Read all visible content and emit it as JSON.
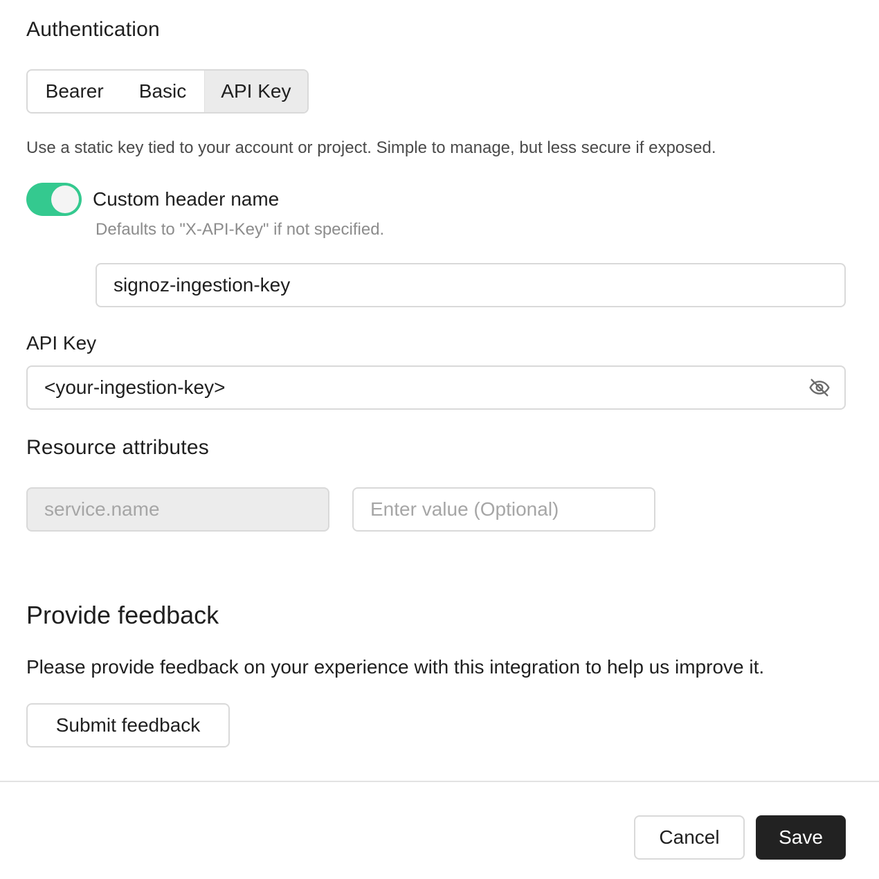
{
  "auth": {
    "title": "Authentication",
    "tabs": [
      {
        "label": "Bearer",
        "selected": false
      },
      {
        "label": "Basic",
        "selected": false
      },
      {
        "label": "API Key",
        "selected": true
      }
    ],
    "description": "Use a static key tied to your account or project. Simple to manage, but less secure if exposed.",
    "custom_header": {
      "enabled": true,
      "label": "Custom header name",
      "hint": "Defaults to \"X-API-Key\" if not specified.",
      "value": "signoz-ingestion-key"
    },
    "api_key": {
      "label": "API Key",
      "value": "<your-ingestion-key>",
      "icon": "eye-off-icon"
    }
  },
  "resource_attributes": {
    "title": "Resource attributes",
    "key_placeholder": "service.name",
    "value_placeholder": "Enter value (Optional)"
  },
  "feedback": {
    "title": "Provide feedback",
    "description": "Please provide feedback on your experience with this integration to help us improve it.",
    "button_label": "Submit feedback"
  },
  "footer": {
    "cancel_label": "Cancel",
    "save_label": "Save"
  },
  "colors": {
    "toggle_on": "#34c98f",
    "primary_button": "#222222",
    "selected_tab": "#ebebeb"
  }
}
